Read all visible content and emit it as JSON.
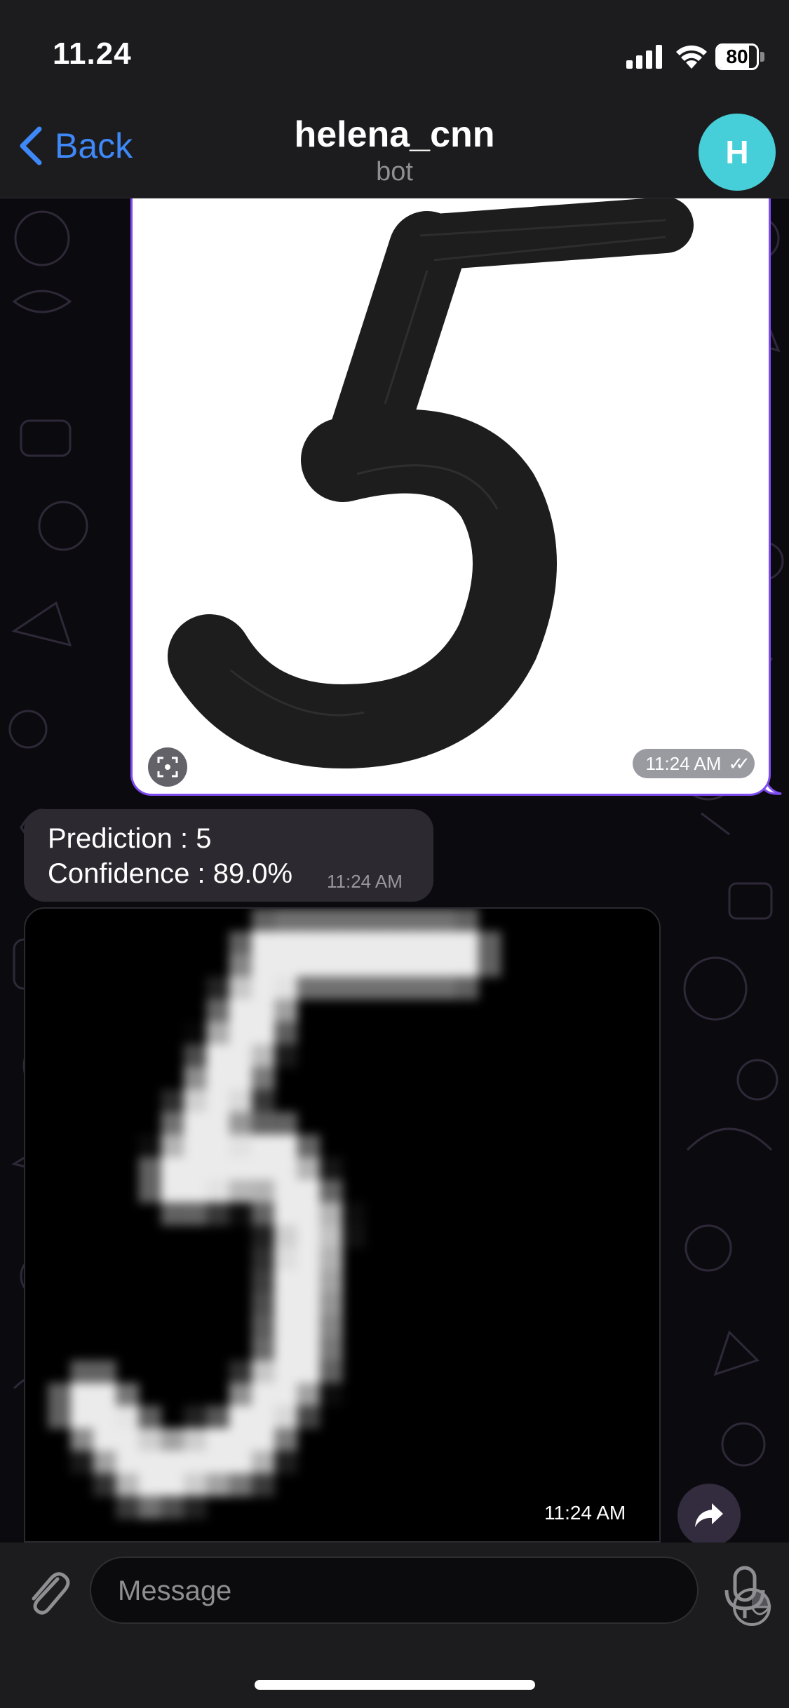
{
  "status_bar": {
    "time": "11.24",
    "battery": "80",
    "battery_level": 0.8
  },
  "header": {
    "back_label": "Back",
    "title": "helena_cnn",
    "subtitle": "bot",
    "avatar_initial": "H",
    "avatar_color": "#46cfd8"
  },
  "messages": {
    "outgoing_photo": {
      "time": "11:24 AM",
      "status_icon": "double-check-icon"
    },
    "prediction": {
      "line1": "Prediction : 5",
      "line2": "Confidence : 89.0%",
      "time": "11:24 AM"
    },
    "processed_photo": {
      "time": "11:24 AM"
    }
  },
  "input_bar": {
    "placeholder": "Message"
  },
  "colors": {
    "accent": "#3e88f7",
    "outgoing_border": "#7e4cf0",
    "incoming_bubble": "#2c2a30",
    "bar_background": "#1c1c1e"
  }
}
